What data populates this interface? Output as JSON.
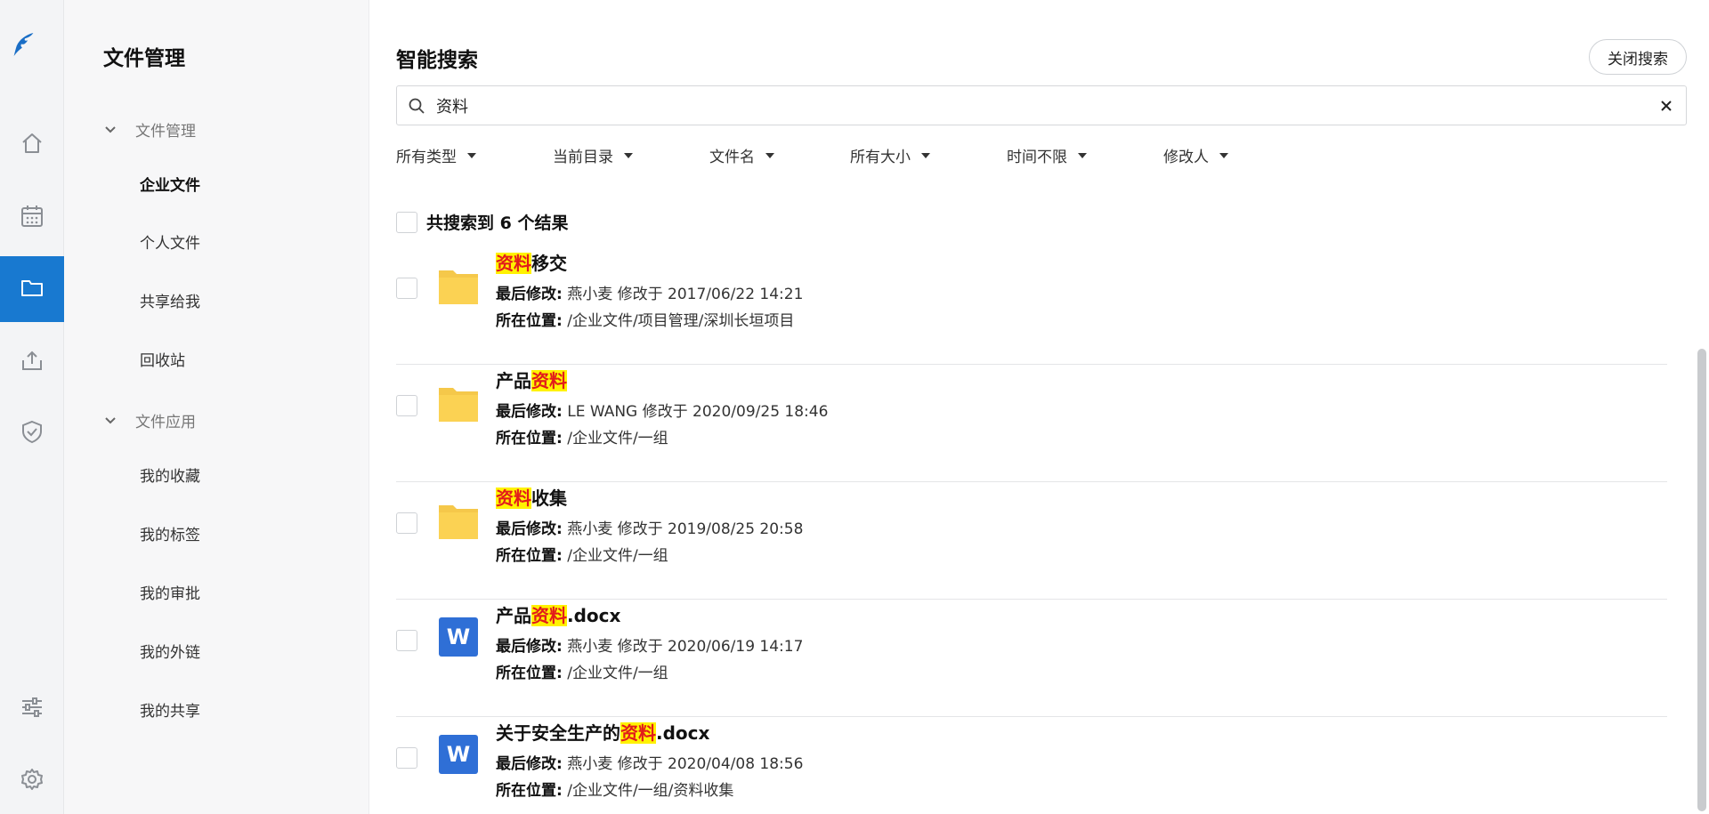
{
  "rail": {
    "icons": [
      "logo-icon",
      "home-icon",
      "calendar-icon",
      "folder-icon",
      "upload-icon",
      "shield-icon",
      "sliders-icon",
      "gear-icon"
    ],
    "accent": "#1879d0"
  },
  "sidebar": {
    "title": "文件管理",
    "group1": "文件管理",
    "group1_items": [
      "企业文件",
      "个人文件",
      "共享给我",
      "回收站"
    ],
    "group2": "文件应用",
    "group2_items": [
      "我的收藏",
      "我的标签",
      "我的审批",
      "我的外链",
      "我的共享"
    ]
  },
  "main": {
    "heading": "智能搜索",
    "close_label": "关闭搜索",
    "search_value": "资料",
    "filters": [
      "所有类型",
      "当前目录",
      "文件名",
      "所有大小",
      "时间不限",
      "修改人"
    ],
    "summary": "共搜索到 6 个结果",
    "modified_label": "最后修改:",
    "location_label": "所在位置:",
    "highlight_color": "#fff200",
    "results": [
      {
        "pre": "",
        "hl": "资料",
        "post": "移交",
        "type": "folder",
        "modified": "燕小麦 修改于 2017/06/22 14:21",
        "location": "/企业文件/项目管理/深圳长垣项目"
      },
      {
        "pre": "产品",
        "hl": "资料",
        "post": "",
        "type": "folder",
        "modified": "LE WANG 修改于 2020/09/25 18:46",
        "location": "/企业文件/一组"
      },
      {
        "pre": "",
        "hl": "资料",
        "post": "收集",
        "type": "folder",
        "modified": "燕小麦 修改于 2019/08/25 20:58",
        "location": "/企业文件/一组"
      },
      {
        "pre": "产品",
        "hl": "资料",
        "post": ".docx",
        "type": "word",
        "modified": "燕小麦 修改于 2020/06/19 14:17",
        "location": "/企业文件/一组"
      },
      {
        "pre": "关于安全生产的",
        "hl": "资料",
        "post": ".docx",
        "type": "word",
        "modified": "燕小麦 修改于 2020/04/08 18:56",
        "location": "/企业文件/一组/资料收集"
      }
    ],
    "word_icon_letter": "W"
  }
}
